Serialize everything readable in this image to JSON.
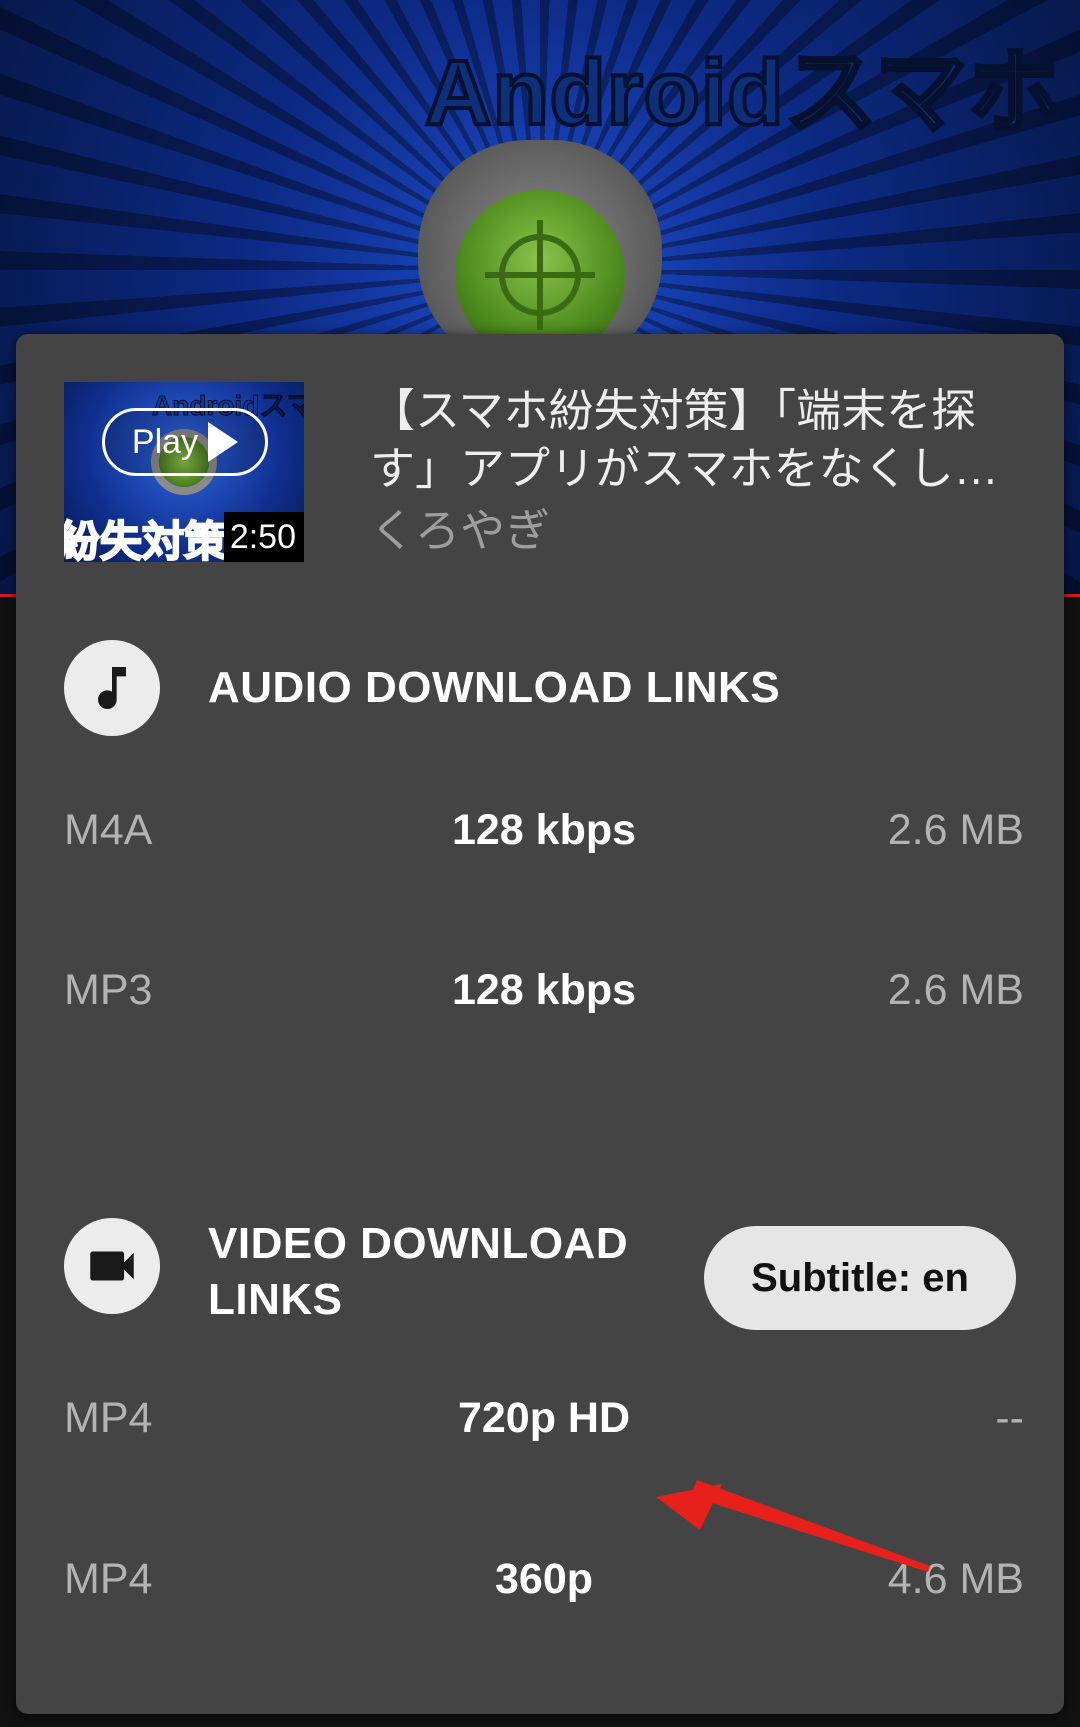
{
  "background": {
    "brand_text": "Androidスマホ"
  },
  "video": {
    "thumbnail_brand": "Androidスマ",
    "thumbnail_caption": "紛失対策",
    "play_label": "Play",
    "duration": "2:50",
    "title": "【スマホ紛失対策】「端末を探す」アプリがスマホをなくした時に役立つ",
    "channel": "くろやぎ"
  },
  "audio_section": {
    "icon": "music-note-icon",
    "label": "AUDIO DOWNLOAD LINKS",
    "rows": [
      {
        "format": "M4A",
        "quality": "128 kbps",
        "size": "2.6 MB"
      },
      {
        "format": "MP3",
        "quality": "128 kbps",
        "size": "2.6 MB"
      }
    ]
  },
  "video_section": {
    "icon": "videocam-icon",
    "label_line1": "VIDEO DOWNLOAD",
    "label_line2": "LINKS",
    "subtitle_button": "Subtitle: en",
    "rows": [
      {
        "format": "MP4",
        "quality": "720p HD",
        "size": "--"
      },
      {
        "format": "MP4",
        "quality": "360p",
        "size": "4.6 MB"
      }
    ]
  },
  "annotation": {
    "arrow_color": "#e8201c"
  },
  "colors": {
    "sheet_bg": "#444444",
    "text_primary": "#ffffff",
    "text_secondary": "#b3b3b3",
    "pill_bg": "#e6e6e6"
  }
}
